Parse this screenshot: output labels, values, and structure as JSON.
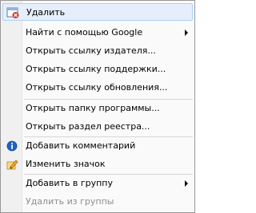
{
  "menu": {
    "items": [
      {
        "label": "Удалить",
        "icon": "delete-window-icon",
        "highlighted": true
      },
      {
        "label": "Найти с помощью Google",
        "submenu": true
      },
      {
        "label": "Открыть ссылку издателя..."
      },
      {
        "label": "Открыть ссылку поддержки..."
      },
      {
        "label": "Открыть ссылку обновления..."
      },
      {
        "label": "Открыть папку программы..."
      },
      {
        "label": "Открыть раздел реестра..."
      },
      {
        "label": "Добавить комментарий",
        "icon": "info-icon"
      },
      {
        "label": "Изменить значок",
        "icon": "edit-icon"
      },
      {
        "label": "Добавить в группу",
        "submenu": true
      },
      {
        "label": "Удалить из группы",
        "disabled": true
      }
    ]
  },
  "colors": {
    "highlight_bg": "#e5eefa",
    "highlight_border": "#aecff7",
    "disabled_text": "#8d8d8d"
  }
}
